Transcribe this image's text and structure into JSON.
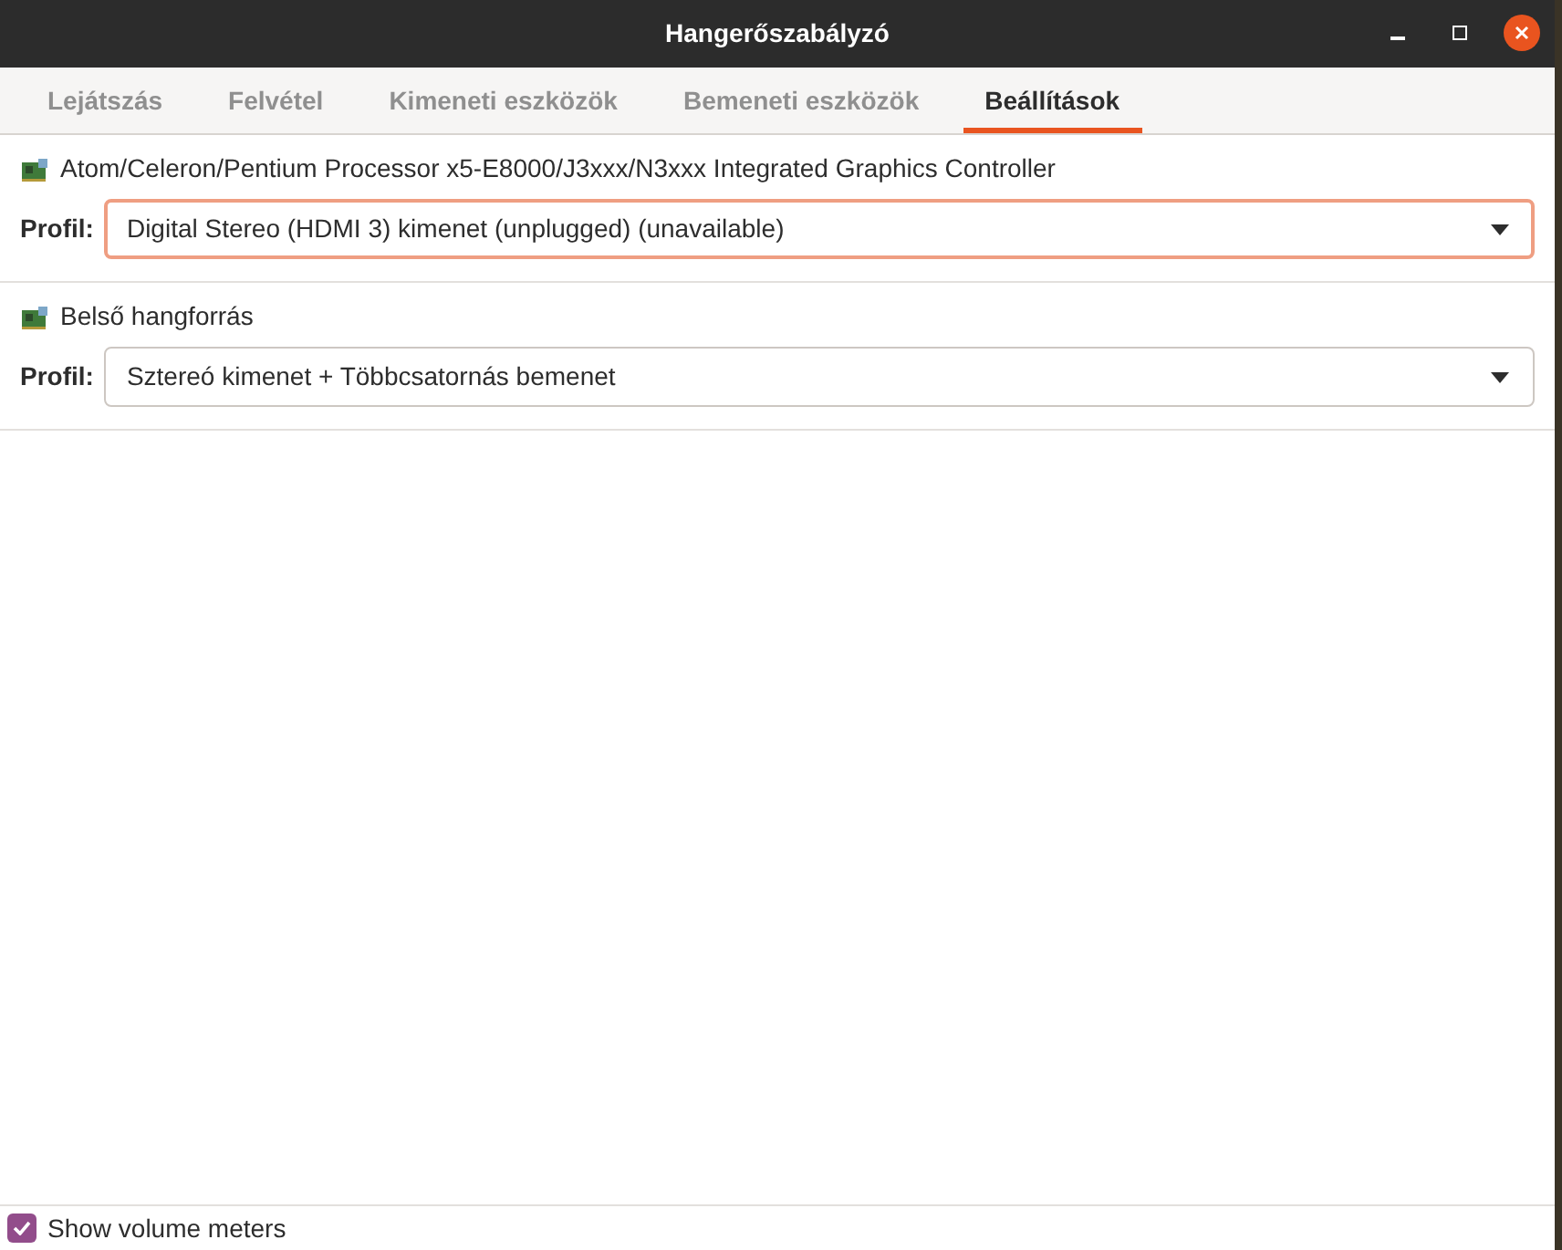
{
  "window": {
    "title": "Hangerőszabályzó"
  },
  "tabs": [
    {
      "label": "Lejátszás",
      "selected": false
    },
    {
      "label": "Felvétel",
      "selected": false
    },
    {
      "label": "Kimeneti eszközök",
      "selected": false
    },
    {
      "label": "Bemeneti eszközök",
      "selected": false
    },
    {
      "label": "Beállítások",
      "selected": true
    }
  ],
  "cards": [
    {
      "name": "Atom/Celeron/Pentium Processor x5-E8000/J3xxx/N3xxx Integrated Graphics Controller",
      "profile_label": "Profil:",
      "profile": "Digital Stereo (HDMI 3) kimenet (unplugged) (unavailable)",
      "focused": true
    },
    {
      "name": "Belső hangforrás",
      "profile_label": "Profil:",
      "profile": "Sztereó kimenet + Többcsatornás bemenet",
      "focused": false
    }
  ],
  "footer": {
    "label": "Show volume meters",
    "checked": true
  }
}
